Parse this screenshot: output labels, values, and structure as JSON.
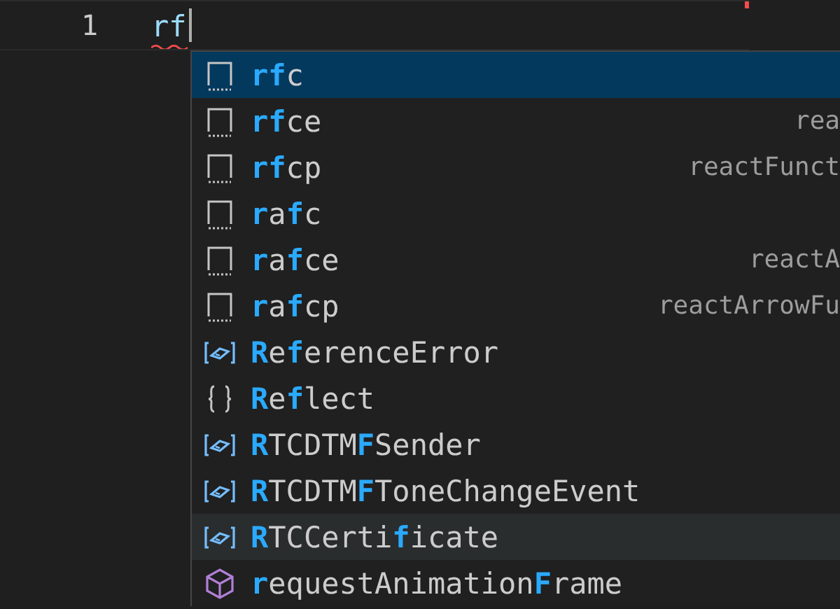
{
  "editor": {
    "line_number": "1",
    "text": "rf",
    "error": true
  },
  "suggestions": [
    {
      "kind": "snippet",
      "label": "**rf**c",
      "selected": true,
      "hovered": false
    },
    {
      "kind": "snippet",
      "label": "**rf**ce",
      "detail": "rea",
      "selected": false,
      "hovered": false
    },
    {
      "kind": "snippet",
      "label": "**rf**cp",
      "detail": "reactFunct",
      "selected": false,
      "hovered": false
    },
    {
      "kind": "snippet",
      "label": "**r**a**f**c",
      "selected": false,
      "hovered": false
    },
    {
      "kind": "snippet",
      "label": "**r**a**f**ce",
      "detail": "reactA",
      "selected": false,
      "hovered": false
    },
    {
      "kind": "snippet",
      "label": "**r**a**f**cp",
      "detail": "reactArrowFu",
      "selected": false,
      "hovered": false
    },
    {
      "kind": "variable",
      "label": "**R**e**f**erenceError",
      "selected": false,
      "hovered": false
    },
    {
      "kind": "module",
      "label": "**R**e**f**lect",
      "selected": false,
      "hovered": false
    },
    {
      "kind": "variable",
      "label": "**R**TCDTM**F**Sender",
      "selected": false,
      "hovered": false
    },
    {
      "kind": "variable",
      "label": "**R**TCDTM**F**ToneChangeEvent",
      "selected": false,
      "hovered": false
    },
    {
      "kind": "variable",
      "label": "**R**TCCerti**f**icate",
      "selected": false,
      "hovered": true
    },
    {
      "kind": "method",
      "label": "**r**equestAnimation**F**rame",
      "selected": false,
      "hovered": false
    }
  ]
}
